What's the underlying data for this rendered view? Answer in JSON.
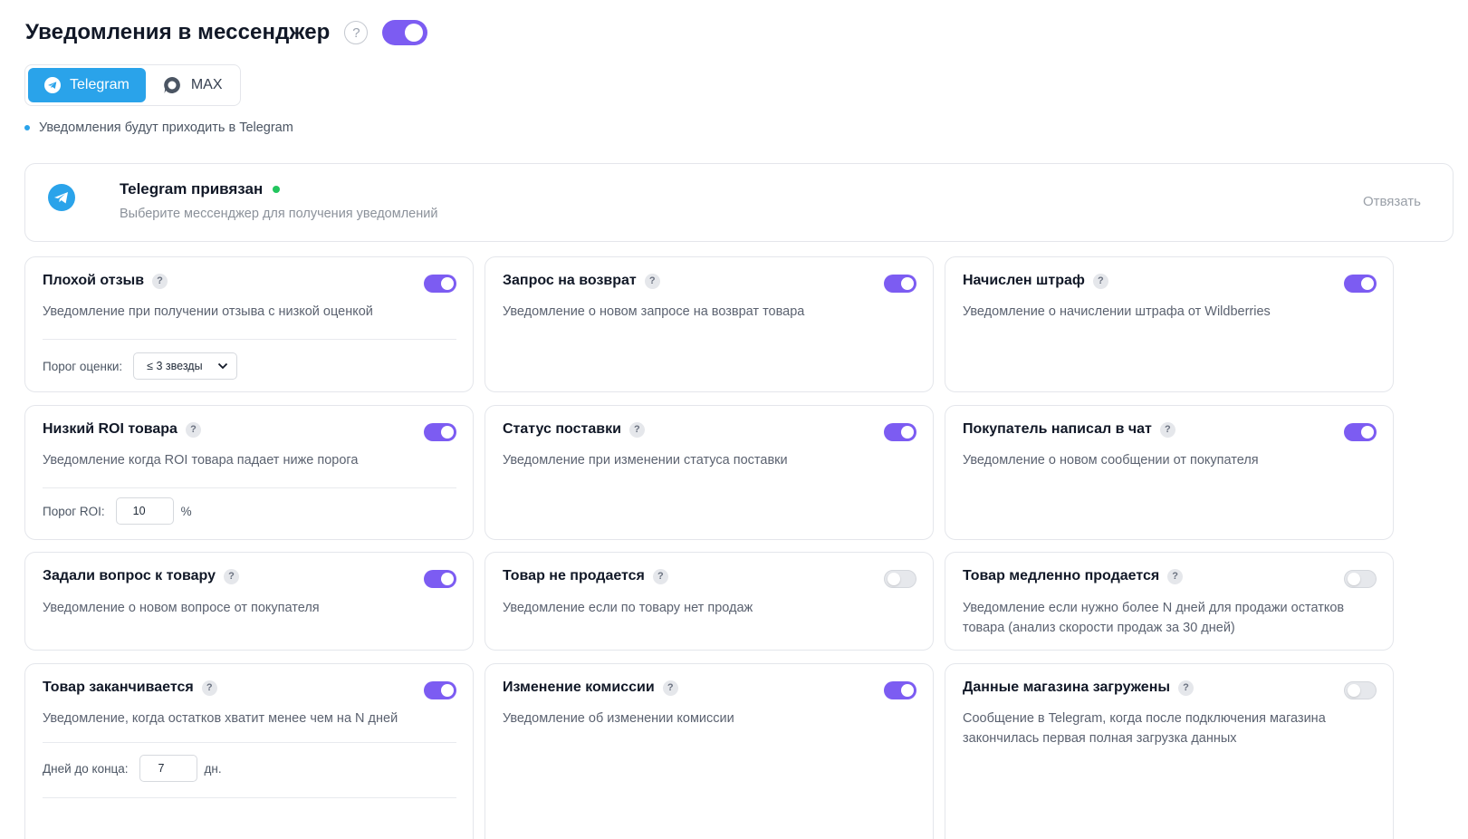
{
  "header": {
    "title": "Уведомления в мессенджер",
    "help": "?",
    "enabled": true
  },
  "messengers": [
    {
      "label": "Telegram",
      "icon": "telegram-icon",
      "active": true
    },
    {
      "label": "MAX",
      "icon": "max-chat-icon",
      "active": false
    }
  ],
  "hint": "Уведомления будут приходить в Telegram",
  "connection": {
    "title": "Telegram привязан",
    "subtitle": "Выберите мессенджер для получения уведомлений",
    "unlink_label": "Отвязать",
    "status_color": "#22c55e"
  },
  "colors": {
    "accent": "#7c5cf2",
    "telegram": "#2aa3ea"
  },
  "cards": [
    {
      "title": "Плохой отзыв",
      "desc": "Уведомление при получении отзыва с низкой оценкой",
      "enabled": true,
      "setting": {
        "label": "Порог оценки:",
        "value": "≤ 3 звезды"
      }
    },
    {
      "title": "Запрос на возврат",
      "desc": "Уведомление о новом запросе на возврат товара",
      "enabled": true
    },
    {
      "title": "Начислен штраф",
      "desc": "Уведомление о начислении штрафа от Wildberries",
      "enabled": true
    },
    {
      "title": "Низкий ROI товара",
      "desc": "Уведомление когда ROI товара падает ниже порога",
      "enabled": true,
      "setting": {
        "label": "Порог ROI:",
        "value": "10",
        "unit": "%"
      }
    },
    {
      "title": "Статус поставки",
      "desc": "Уведомление при изменении статуса поставки",
      "enabled": true
    },
    {
      "title": "Покупатель написал в чат",
      "desc": "Уведомление о новом сообщении от покупателя",
      "enabled": true
    },
    {
      "title": "Задали вопрос к товару",
      "desc": "Уведомление о новом вопросе от покупателя",
      "enabled": true
    },
    {
      "title": "Товар не продается",
      "desc": "Уведомление если по товару нет продаж",
      "enabled": false
    },
    {
      "title": "Товар медленно продается",
      "desc": "Уведомление если нужно более N дней для продажи остатков товара (анализ скорости продаж за 30 дней)",
      "enabled": false
    },
    {
      "title": "Товар заканчивается",
      "desc": "Уведомление, когда остатков хватит менее чем на N дней",
      "enabled": true,
      "setting": {
        "label": "Дней до конца:",
        "value": "7",
        "unit": "дн."
      }
    },
    {
      "title": "Изменение комиссии",
      "desc": "Уведомление об изменении комиссии",
      "enabled": true
    },
    {
      "title": "Данные магазина загружены",
      "desc": "Сообщение в Telegram, когда после подключения магазина закончилась первая полная загрузка данных",
      "enabled": false
    }
  ]
}
